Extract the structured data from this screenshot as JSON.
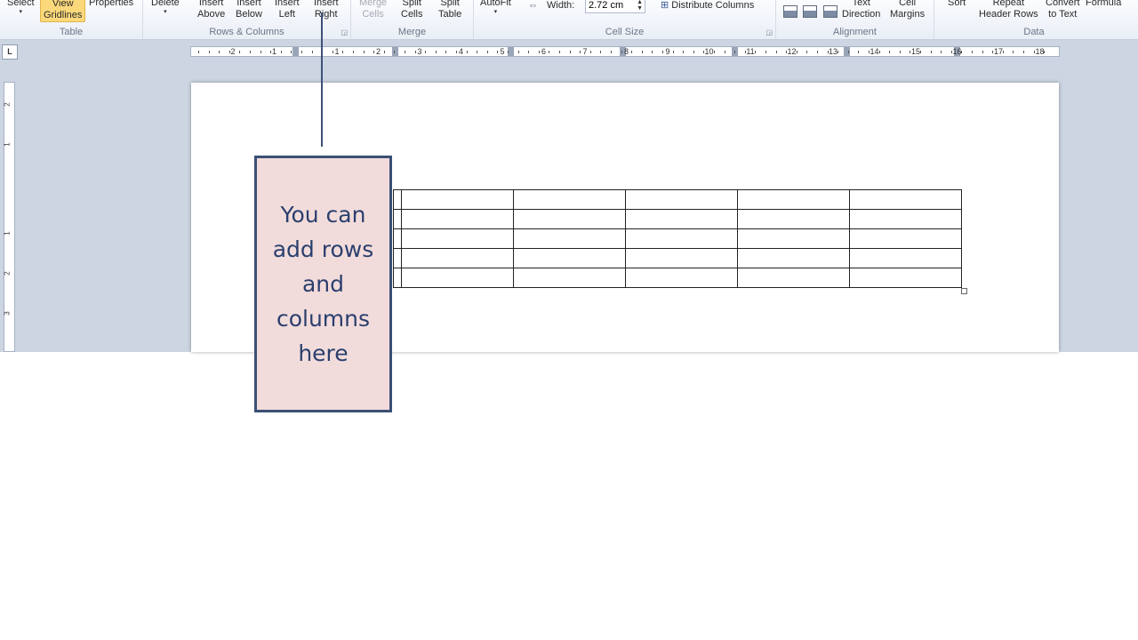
{
  "ribbon": {
    "groups": {
      "table": {
        "title": "Table",
        "select": "Select",
        "view_gridlines_1": "View",
        "view_gridlines_2": "Gridlines",
        "properties": "Properties"
      },
      "rows_columns": {
        "title": "Rows & Columns",
        "delete": "Delete",
        "insert_above_1": "Insert",
        "insert_above_2": "Above",
        "insert_below_1": "Insert",
        "insert_below_2": "Below",
        "insert_left_1": "Insert",
        "insert_left_2": "Left",
        "insert_right_1": "Insert",
        "insert_right_2": "Right"
      },
      "merge": {
        "title": "Merge",
        "merge_cells_1": "Merge",
        "merge_cells_2": "Cells",
        "split_cells_1": "Split",
        "split_cells_2": "Cells",
        "split_table_1": "Split",
        "split_table_2": "Table"
      },
      "cell_size": {
        "title": "Cell Size",
        "autofit": "AutoFit",
        "width_label": "Width:",
        "width_value": "2.72 cm",
        "distribute_columns": "Distribute Columns"
      },
      "alignment": {
        "title": "Alignment",
        "text_direction_1": "Text",
        "text_direction_2": "Direction",
        "cell_margins_1": "Cell",
        "cell_margins_2": "Margins"
      },
      "data": {
        "title": "Data",
        "sort": "Sort",
        "repeat_header_rows_1": "Repeat",
        "repeat_header_rows_2": "Header Rows",
        "convert_to_text_1": "Convert",
        "convert_to_text_2": "to Text",
        "formula": "Formula"
      }
    }
  },
  "ruler": {
    "tab_selector": "L",
    "left_numbers": [
      "2",
      "1"
    ],
    "right_numbers": [
      "1",
      "2",
      "3",
      "4",
      "5",
      "6",
      "7",
      "8",
      "9",
      "10",
      "11",
      "12",
      "13",
      "14",
      "15",
      "16",
      "17",
      "18"
    ],
    "vertical_numbers": [
      "2",
      "1",
      "1",
      "2",
      "3"
    ]
  },
  "document": {
    "table": {
      "rows": 5,
      "columns": 6
    }
  },
  "callout": {
    "text": "You can add rows and columns here"
  },
  "colors": {
    "callout_fill": "#f2dcdb",
    "callout_border": "#3b5074",
    "callout_text": "#2b3f6e",
    "active_button": "#fbd97b"
  }
}
